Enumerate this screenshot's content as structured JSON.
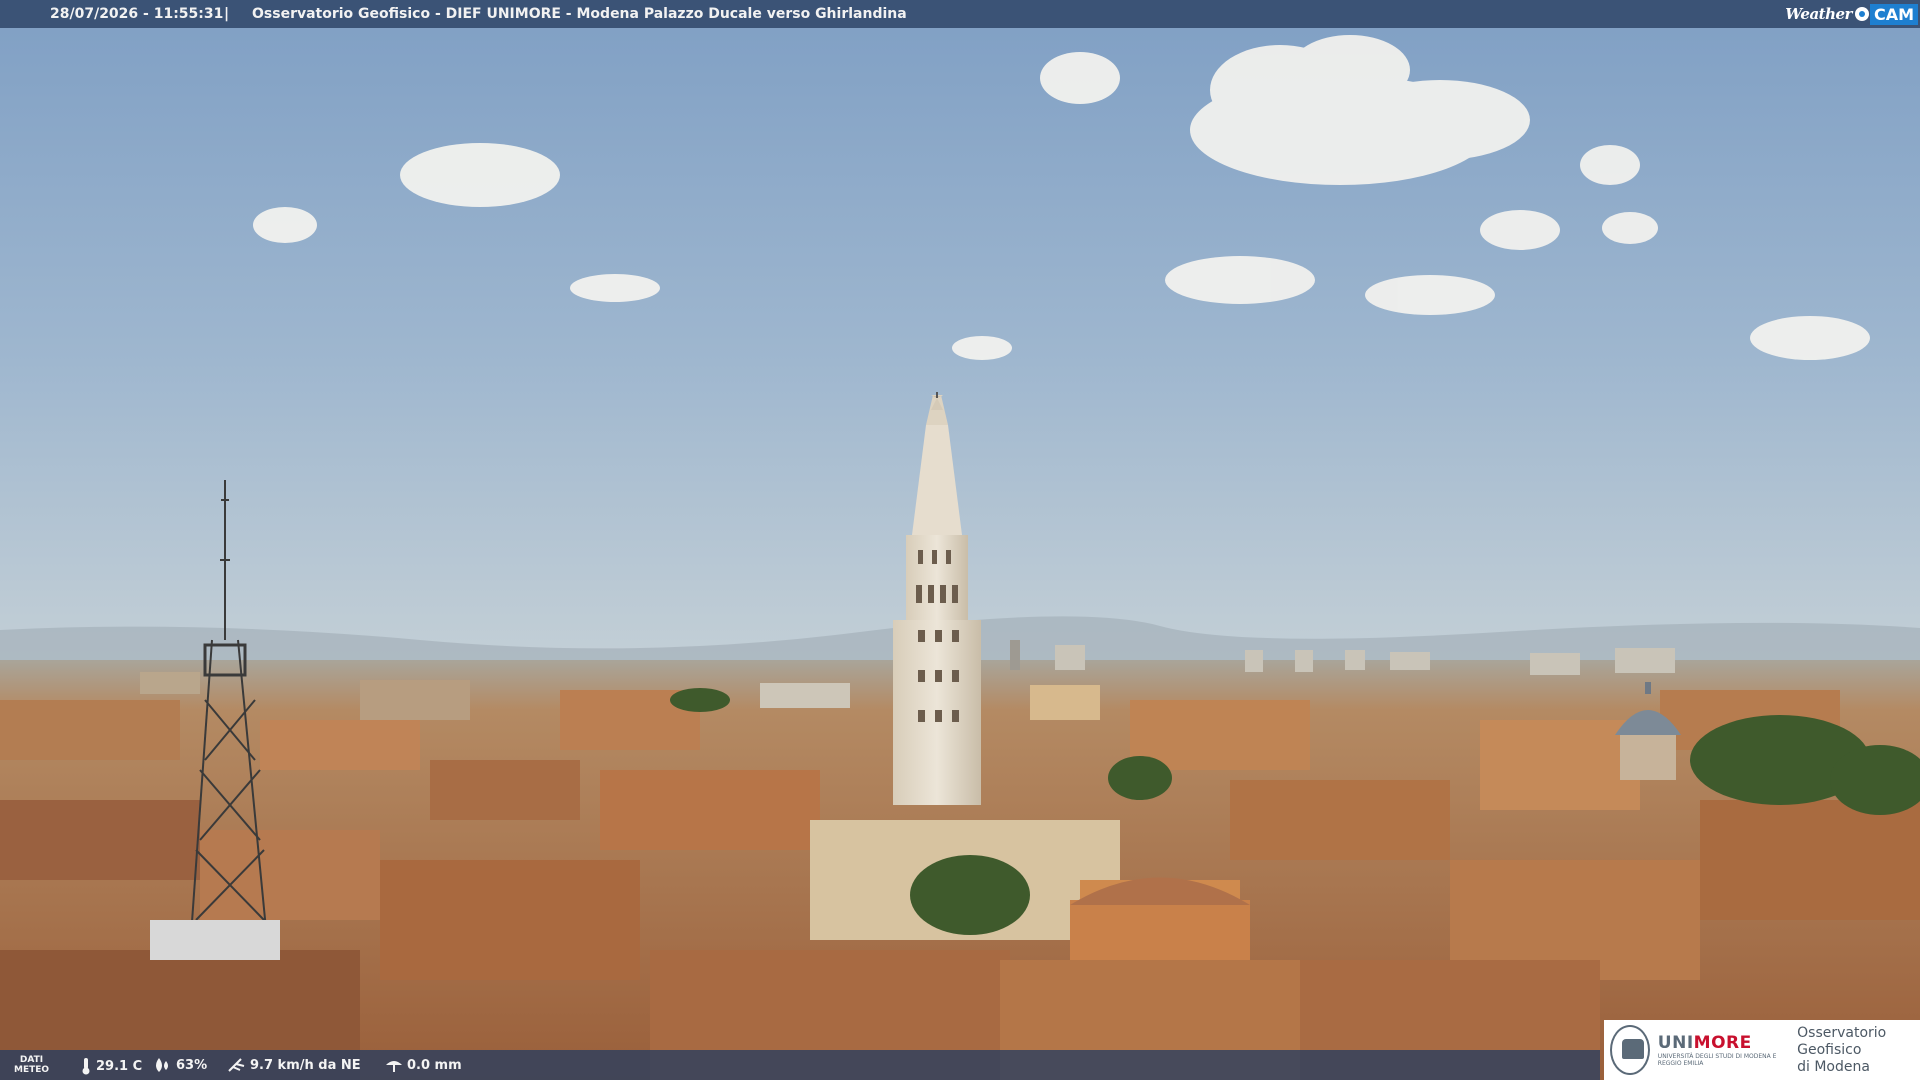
{
  "header": {
    "timestamp": "28/07/2026 - 11:55:31",
    "separator": "|",
    "title": "Osservatorio Geofisico - DIEF UNIMORE - Modena Palazzo Ducale verso Ghirlandina",
    "brand_weather": "Weather",
    "brand_cam": "CAM"
  },
  "meteo": {
    "label_line1": "DATI",
    "label_line2": "METEO",
    "temperature": "29.1 C",
    "humidity": "63%",
    "wind": "9.7 km/h da NE",
    "rain": "0.0 mm",
    "icons": [
      "thermometer-icon",
      "humidity-drop-icon",
      "wind-icon",
      "rain-icon"
    ]
  },
  "logo": {
    "uni_prefix": "UNI",
    "uni_suffix": "MORE",
    "uni_sub": "UNIVERSITÀ DEGLI STUDI DI MODENA E REGGIO EMILIA",
    "osserv_line1": "Osservatorio Geofisico",
    "osserv_line2": "di Modena"
  },
  "colors": {
    "sky_top": "#7e9fc4",
    "sky_bottom": "#b9cad6",
    "roof": "#b87a4e",
    "tower": "#e6ddce",
    "bar": "#283e60",
    "brand_blue": "#1e7fd0",
    "unimore_red": "#c8102e"
  }
}
